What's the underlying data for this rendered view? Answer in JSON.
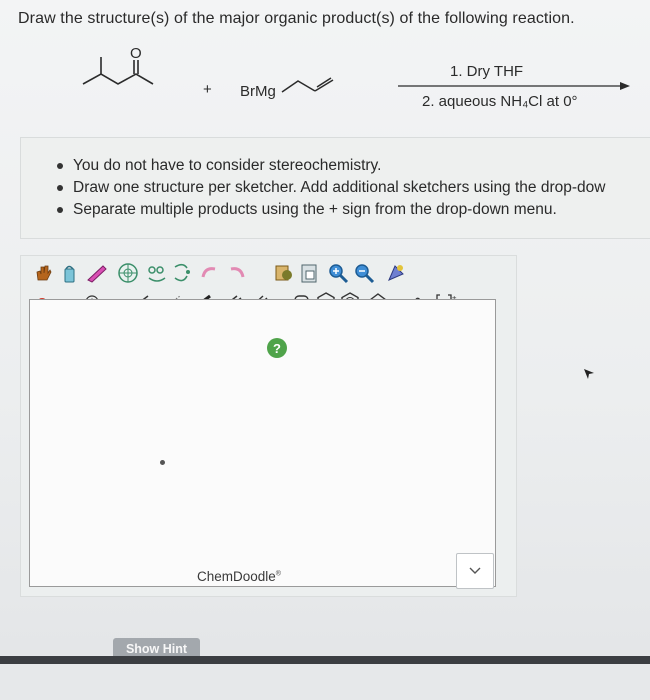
{
  "question": {
    "prompt": "Draw the structure(s) of the major organic product(s) of the following reaction."
  },
  "reaction": {
    "plus": "+",
    "grignard": "BrMg",
    "oxygen_label": "O",
    "condition_1": "1. Dry THF",
    "condition_2": "2. aqueous NH₄Cl at 0°"
  },
  "instructions": {
    "items": [
      "You do not have to consider stereochemistry.",
      "Draw one structure per sketcher. Add additional sketchers using the drop-dow",
      "Separate multiple products using the + sign from the drop-down menu."
    ]
  },
  "sketcher": {
    "help_label": "?",
    "brand": "ChemDoodle",
    "brand_mark": "®",
    "atom_selector": "O",
    "toolbar_icons": [
      "hand-icon",
      "eraser-icon",
      "lasso-icon",
      "ring-template-icon",
      "clean-icon",
      "undo-icon",
      "redo-icon",
      "copy-icon",
      "paste-icon",
      "zoom-in-icon",
      "zoom-out-icon",
      "center-icon",
      "atom-o-icon",
      "charge-icon",
      "single-bond-icon",
      "stereo-bond-icon",
      "bold-bond-icon",
      "double-bond-icon",
      "triple-bond-icon",
      "cyclopropane-icon",
      "cyclohexane-icon",
      "benzene-icon",
      "cyclopentane-icon",
      "shape-icon",
      "bracket-icon"
    ]
  },
  "footer": {
    "hint_button": "Show Hint"
  },
  "colors": {
    "help_green": "#4fa34a",
    "hint_gray": "#a3a8ad",
    "bar_dark": "#3b3e42"
  }
}
